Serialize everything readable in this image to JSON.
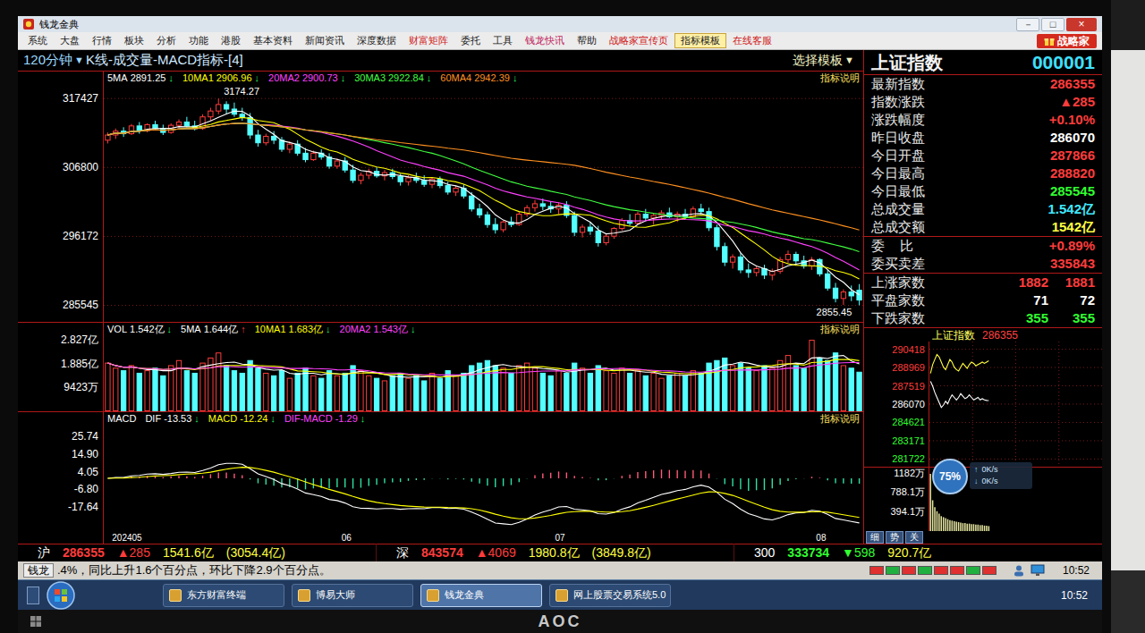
{
  "window": {
    "title": "钱龙金典",
    "controls": [
      "－",
      "□",
      "×"
    ]
  },
  "menu": {
    "items": [
      {
        "label": "系统",
        "color": "#1a1a1a",
        "highlighted": false
      },
      {
        "label": "大盘",
        "color": "#1a1a1a",
        "highlighted": false
      },
      {
        "label": "行情",
        "color": "#1a1a1a",
        "highlighted": false
      },
      {
        "label": "板块",
        "color": "#1a1a1a",
        "highlighted": false
      },
      {
        "label": "分析",
        "color": "#1a1a1a",
        "highlighted": false
      },
      {
        "label": "功能",
        "color": "#1a1a1a",
        "highlighted": false
      },
      {
        "label": "港股",
        "color": "#1a1a1a",
        "highlighted": false
      },
      {
        "label": "基本资料",
        "color": "#1a1a1a",
        "highlighted": false
      },
      {
        "label": "新闻资讯",
        "color": "#1a1a1a",
        "highlighted": false
      },
      {
        "label": "深度数据",
        "color": "#1a1a1a",
        "highlighted": false
      },
      {
        "label": "财富矩阵",
        "color": "#d01818",
        "highlighted": false
      },
      {
        "label": "委托",
        "color": "#1a1a1a",
        "highlighted": false
      },
      {
        "label": "工具",
        "color": "#1a1a1a",
        "highlighted": false
      },
      {
        "label": "钱龙快讯",
        "color": "#c0185a",
        "highlighted": false
      },
      {
        "label": "帮助",
        "color": "#1a1a1a",
        "highlighted": false
      },
      {
        "label": "战略家宣传页",
        "color": "#d01818",
        "highlighted": false
      },
      {
        "label": "指标模板",
        "color": "#1a1a1a",
        "highlighted": true
      },
      {
        "label": "在线客服",
        "color": "#d01818",
        "highlighted": false
      }
    ],
    "promo": {
      "label": "战略家"
    }
  },
  "chart_header": {
    "period": "120分钟",
    "period_arrow": "▼",
    "title": "K线-成交量-MACD指标-[4]",
    "template": "选择模板",
    "template_arrow": "▼"
  },
  "main_chart": {
    "legend": [
      {
        "label": "5MA",
        "value": "2891.25",
        "arrow": "↓",
        "rising": false,
        "color": "#ffffff",
        "period": 5
      },
      {
        "label": "10MA1",
        "value": "2906.96",
        "arrow": "↓",
        "rising": false,
        "color": "#ffff00",
        "period": 10
      },
      {
        "label": "20MA2",
        "value": "2900.73",
        "arrow": "↓",
        "rising": false,
        "color": "#ff40ff",
        "period": 20
      },
      {
        "label": "30MA3",
        "value": "2922.84",
        "arrow": "↓",
        "rising": false,
        "color": "#40ff40",
        "period": 30
      },
      {
        "label": "60MA4",
        "value": "2942.39",
        "arrow": "↓",
        "rising": false,
        "color": "#ff9020",
        "period": 60
      }
    ],
    "info": "指标说明",
    "ticks": [
      {
        "label": "317427",
        "value": 3174.27
      },
      {
        "label": "306800",
        "value": 3068.0
      },
      {
        "label": "296172",
        "value": 2961.72
      },
      {
        "label": "285545",
        "value": 2855.45
      }
    ],
    "high_label": "3174.27",
    "low_label": "2855.45",
    "candles": [
      [
        3110,
        3122,
        3105,
        3118
      ],
      [
        3118,
        3128,
        3112,
        3124
      ],
      [
        3124,
        3130,
        3115,
        3120
      ],
      [
        3120,
        3135,
        3118,
        3132
      ],
      [
        3132,
        3138,
        3120,
        3125
      ],
      [
        3125,
        3136,
        3122,
        3134
      ],
      [
        3134,
        3140,
        3126,
        3128
      ],
      [
        3128,
        3134,
        3118,
        3122
      ],
      [
        3122,
        3136,
        3120,
        3133
      ],
      [
        3133,
        3142,
        3128,
        3138
      ],
      [
        3138,
        3146,
        3130,
        3132
      ],
      [
        3132,
        3140,
        3125,
        3128
      ],
      [
        3128,
        3150,
        3126,
        3146
      ],
      [
        3146,
        3160,
        3140,
        3155
      ],
      [
        3155,
        3174.27,
        3150,
        3165
      ],
      [
        3165,
        3170,
        3150,
        3158
      ],
      [
        3158,
        3168,
        3146,
        3150
      ],
      [
        3150,
        3160,
        3140,
        3145
      ],
      [
        3145,
        3152,
        3112,
        3118
      ],
      [
        3118,
        3126,
        3100,
        3106
      ],
      [
        3106,
        3120,
        3102,
        3116
      ],
      [
        3116,
        3124,
        3104,
        3110
      ],
      [
        3110,
        3115,
        3092,
        3096
      ],
      [
        3096,
        3108,
        3090,
        3104
      ],
      [
        3104,
        3110,
        3086,
        3090
      ],
      [
        3090,
        3098,
        3076,
        3080
      ],
      [
        3080,
        3094,
        3078,
        3090
      ],
      [
        3090,
        3096,
        3080,
        3084
      ],
      [
        3084,
        3090,
        3066,
        3070
      ],
      [
        3070,
        3082,
        3066,
        3078
      ],
      [
        3078,
        3084,
        3060,
        3064
      ],
      [
        3064,
        3072,
        3044,
        3048
      ],
      [
        3048,
        3060,
        3042,
        3056
      ],
      [
        3056,
        3066,
        3050,
        3062
      ],
      [
        3062,
        3068,
        3052,
        3055
      ],
      [
        3055,
        3064,
        3048,
        3060
      ],
      [
        3060,
        3066,
        3050,
        3054
      ],
      [
        3054,
        3058,
        3040,
        3046
      ],
      [
        3046,
        3056,
        3040,
        3052
      ],
      [
        3052,
        3060,
        3044,
        3048
      ],
      [
        3048,
        3056,
        3038,
        3042
      ],
      [
        3042,
        3052,
        3036,
        3050
      ],
      [
        3050,
        3054,
        3036,
        3040
      ],
      [
        3040,
        3046,
        3026,
        3030
      ],
      [
        3030,
        3040,
        3024,
        3036
      ],
      [
        3036,
        3042,
        3020,
        3024
      ],
      [
        3024,
        3030,
        3000,
        3004
      ],
      [
        3004,
        3012,
        2990,
        2995
      ],
      [
        2995,
        3000,
        2975,
        2980
      ],
      [
        2980,
        2990,
        2966,
        2972
      ],
      [
        2972,
        2986,
        2968,
        2984
      ],
      [
        2984,
        2992,
        2976,
        2980
      ],
      [
        2980,
        3000,
        2978,
        2996
      ],
      [
        2996,
        3010,
        2992,
        3006
      ],
      [
        3006,
        3018,
        3000,
        3012
      ],
      [
        3012,
        3020,
        3002,
        3008
      ],
      [
        3008,
        3016,
        2998,
        3004
      ],
      [
        3004,
        3014,
        2996,
        3010
      ],
      [
        3010,
        3016,
        2990,
        2994
      ],
      [
        2994,
        3000,
        2962,
        2968
      ],
      [
        2968,
        2980,
        2960,
        2976
      ],
      [
        2976,
        2984,
        2964,
        2970
      ],
      [
        2970,
        2978,
        2946,
        2952
      ],
      [
        2952,
        2966,
        2948,
        2962
      ],
      [
        2962,
        2976,
        2958,
        2974
      ],
      [
        2974,
        2990,
        2970,
        2986
      ],
      [
        2986,
        2996,
        2978,
        2982
      ],
      [
        2982,
        3000,
        2980,
        2996
      ],
      [
        2996,
        3004,
        2986,
        2990
      ],
      [
        2990,
        2998,
        2980,
        2994
      ],
      [
        2994,
        3002,
        2988,
        2998
      ],
      [
        2998,
        3006,
        2990,
        2992
      ],
      [
        2992,
        3000,
        2984,
        2996
      ],
      [
        2996,
        3004,
        2988,
        2992
      ],
      [
        2992,
        3008,
        2990,
        3004
      ],
      [
        3004,
        3012,
        2996,
        3000
      ],
      [
        3000,
        3006,
        2970,
        2975
      ],
      [
        2975,
        2980,
        2940,
        2946
      ],
      [
        2946,
        2952,
        2916,
        2922
      ],
      [
        2922,
        2934,
        2912,
        2930
      ],
      [
        2930,
        2936,
        2905,
        2910
      ],
      [
        2910,
        2920,
        2898,
        2906
      ],
      [
        2906,
        2916,
        2900,
        2912
      ],
      [
        2912,
        2918,
        2896,
        2902
      ],
      [
        2902,
        2912,
        2894,
        2908
      ],
      [
        2908,
        2930,
        2904,
        2926
      ],
      [
        2926,
        2940,
        2920,
        2934
      ],
      [
        2934,
        2938,
        2918,
        2924
      ],
      [
        2924,
        2932,
        2912,
        2916
      ],
      [
        2916,
        2930,
        2910,
        2926
      ],
      [
        2926,
        2928,
        2900,
        2904
      ],
      [
        2904,
        2910,
        2878,
        2882
      ],
      [
        2882,
        2890,
        2860,
        2866
      ],
      [
        2866,
        2880,
        2856,
        2876
      ],
      [
        2876,
        2886,
        2862,
        2870
      ],
      [
        2878.66,
        2888.2,
        2855.45,
        2863.55
      ]
    ]
  },
  "volume": {
    "legend": {
      "label": "VOL",
      "value": "1.542亿",
      "arrow": "↓",
      "rising": false,
      "color": "#ffffff"
    },
    "ma": [
      {
        "label": "5MA",
        "value": "1.644亿",
        "arrow": "↑",
        "rising": true,
        "color": "#ffffff",
        "period": 5
      },
      {
        "label": "10MA1",
        "value": "1.683亿",
        "arrow": "↓",
        "rising": false,
        "color": "#ffff00",
        "period": 10
      },
      {
        "label": "20MA2",
        "value": "1.543亿",
        "arrow": "↓",
        "rising": false,
        "color": "#ff40ff",
        "period": 20
      }
    ],
    "info": "指标说明",
    "ticks": [
      {
        "label": "2.827亿",
        "value": 2.827
      },
      {
        "label": "1.885亿",
        "value": 1.885
      },
      {
        "label": "9423万",
        "value": 0.9423
      }
    ],
    "values": [
      1.9,
      1.7,
      1.6,
      1.8,
      1.5,
      1.6,
      1.7,
      1.4,
      1.8,
      2.0,
      1.6,
      1.5,
      1.9,
      2.1,
      2.3,
      1.8,
      1.6,
      1.5,
      2.0,
      1.7,
      1.5,
      1.4,
      1.6,
      1.3,
      1.5,
      1.7,
      1.4,
      1.3,
      1.6,
      1.4,
      1.5,
      1.8,
      1.6,
      1.4,
      1.3,
      1.2,
      1.4,
      1.5,
      1.3,
      1.4,
      1.2,
      1.5,
      1.3,
      1.6,
      1.4,
      1.5,
      1.8,
      1.9,
      2.0,
      1.8,
      1.7,
      1.5,
      1.8,
      1.9,
      1.7,
      1.5,
      1.4,
      1.6,
      1.5,
      1.9,
      1.7,
      1.5,
      1.8,
      1.6,
      1.5,
      1.7,
      1.5,
      1.6,
      1.4,
      1.5,
      1.3,
      1.4,
      1.5,
      1.4,
      1.6,
      1.5,
      1.9,
      2.0,
      2.1,
      1.8,
      1.9,
      1.7,
      1.6,
      1.8,
      1.7,
      2.0,
      2.2,
      1.8,
      1.7,
      2.8,
      2.1,
      2.0,
      2.3,
      1.8,
      1.7,
      1.542
    ]
  },
  "macd": {
    "title": "MACD",
    "items": [
      {
        "label": "DIF",
        "value": "-13.53",
        "arrow": "↓",
        "rising": false,
        "color": "#ffffff"
      },
      {
        "label": "MACD",
        "value": "-12.24",
        "arrow": "↓",
        "rising": false,
        "color": "#ffff00"
      },
      {
        "label": "DIF-MACD",
        "value": "-1.29",
        "arrow": "↓",
        "rising": false,
        "color": "#ff40ff"
      }
    ],
    "info": "指标说明",
    "ticks": [
      {
        "label": "25.74",
        "value": 25.74
      },
      {
        "label": "14.90",
        "value": 14.9
      },
      {
        "label": "4.05",
        "value": 4.05
      },
      {
        "label": "-6.80",
        "value": -6.8
      },
      {
        "label": "-17.64",
        "value": -17.64
      }
    ]
  },
  "x_axis": [
    {
      "label": "202405",
      "candle": 1
    },
    {
      "label": "06",
      "candle": 30
    },
    {
      "label": "07",
      "candle": 57
    },
    {
      "label": "08",
      "candle": 90
    }
  ],
  "quote": {
    "name": "上证指数",
    "code": "000001",
    "groups": [
      {
        "rows": [
          {
            "label": "最新指数",
            "values": [
              "286355"
            ],
            "color": "#ff3c3c"
          },
          {
            "label": "指数涨跌",
            "values": [
              "▲285"
            ],
            "color": "#ff3c3c"
          },
          {
            "label": "涨跌幅度",
            "values": [
              "+0.10%"
            ],
            "color": "#ff3c3c"
          },
          {
            "label": "昨日收盘",
            "values": [
              "286070"
            ],
            "color": "#ffffff"
          },
          {
            "label": "今日开盘",
            "values": [
              "287866"
            ],
            "color": "#ff3c3c"
          },
          {
            "label": "今日最高",
            "values": [
              "288820"
            ],
            "color": "#ff3c3c"
          },
          {
            "label": "今日最低",
            "values": [
              "285545"
            ],
            "color": "#30ff30"
          },
          {
            "label": "总成交量",
            "values": [
              "1.542亿"
            ],
            "color": "#40e8ff"
          },
          {
            "label": "总成交额",
            "values": [
              "1542亿"
            ],
            "color": "#ffff40"
          }
        ]
      },
      {
        "rows": [
          {
            "label": "委    比",
            "values": [
              "+0.89%"
            ],
            "color": "#ff3c3c"
          },
          {
            "label": "委买卖差",
            "values": [
              "335843"
            ],
            "color": "#ff3c3c"
          }
        ]
      },
      {
        "rows": [
          {
            "label": "上涨家数",
            "values": [
              "1882",
              "1881"
            ],
            "color": "#ff3c3c"
          },
          {
            "label": "平盘家数",
            "values": [
              "71",
              "72"
            ],
            "color": "#ffffff"
          },
          {
            "label": "下跌家数",
            "values": [
              "355",
              "355"
            ],
            "color": "#30ff30"
          }
        ]
      }
    ]
  },
  "intraday": {
    "name": "上证指数",
    "value": "286355",
    "price_ticks": [
      {
        "label": "290418",
        "value": 2904.18,
        "color": "#ff3c3c"
      },
      {
        "label": "288969",
        "value": 2889.69,
        "color": "#ff3c3c"
      },
      {
        "label": "287519",
        "value": 2875.19,
        "color": "#ff3c3c"
      },
      {
        "label": "286070",
        "value": 2860.7,
        "color": "#ffffff"
      },
      {
        "label": "284621",
        "value": 2846.21,
        "color": "#30ff30"
      },
      {
        "label": "283171",
        "value": 2831.71,
        "color": "#30ff30"
      },
      {
        "label": "281722",
        "value": 2817.22,
        "color": "#30ff30"
      }
    ],
    "volume_ticks": [
      {
        "label": "1182万",
        "value": 1182
      },
      {
        "label": "788.1万",
        "value": 788.1
      },
      {
        "label": "394.1万",
        "value": 394.1
      }
    ],
    "slots": 80,
    "index": [
      2878.7,
      2875,
      2870,
      2866,
      2862,
      2858,
      2860,
      2863,
      2861,
      2865,
      2868,
      2866,
      2864,
      2866,
      2869,
      2867,
      2865,
      2866,
      2868,
      2866,
      2864,
      2865,
      2866,
      2864,
      2865,
      2864,
      2863.6,
      2863.55
    ],
    "lead": [
      2885,
      2892,
      2896,
      2900,
      2898,
      2894,
      2890,
      2888,
      2892,
      2896,
      2894,
      2890,
      2888,
      2887,
      2890,
      2893,
      2891,
      2889,
      2892,
      2894,
      2893,
      2891,
      2892,
      2893,
      2894,
      2893,
      2894,
      2895
    ],
    "volume": [
      1150,
      620,
      480,
      400,
      350,
      300,
      280,
      260,
      240,
      220,
      210,
      200,
      190,
      180,
      170,
      160,
      160,
      150,
      150,
      140,
      140,
      130,
      130,
      120,
      120,
      110,
      110,
      100
    ],
    "tabs": [
      {
        "label": "细",
        "selected": false
      },
      {
        "label": "势",
        "selected": false
      },
      {
        "label": "关",
        "selected": false
      }
    ]
  },
  "net_widget": {
    "percent": "75%",
    "up_icon": "↑",
    "up": "0K/s",
    "down_icon": "↓",
    "down": "0K/s"
  },
  "ticker": [
    {
      "label": "沪",
      "value": "286355",
      "change": "▲285",
      "amount": "1541.6亿",
      "amount2": "(3054.4亿)",
      "color": "#ff3c3c"
    },
    {
      "label": "深",
      "value": "843574",
      "change": "▲4069",
      "amount": "1980.8亿",
      "amount2": "(3849.8亿)",
      "color": "#ff3c3c"
    },
    {
      "label": "300",
      "value": "333734",
      "change": "▼598",
      "amount": "920.7亿",
      "color": "#30ff30"
    }
  ],
  "news": {
    "source": "钱龙",
    "text": ".4%，同比上升1.6个百分点，环比下降2.9个百分点。",
    "clock": "10:52"
  },
  "status_blocks": [
    {
      "color": "#e03030"
    },
    {
      "color": "#20b040"
    },
    {
      "color": "#e03030"
    },
    {
      "color": "#20b040"
    },
    {
      "color": "#e03030"
    },
    {
      "color": "#e03030"
    },
    {
      "color": "#20b040"
    },
    {
      "color": "#e03030"
    }
  ],
  "taskbar": {
    "items": [
      {
        "label": "东方财富终端",
        "selected": false
      },
      {
        "label": "博易大师",
        "selected": false
      },
      {
        "label": "钱龙金典",
        "selected": true
      },
      {
        "label": "网上股票交易系统5.0",
        "selected": false
      }
    ],
    "clock": "10:52"
  },
  "monitor": {
    "brand": "AOC"
  }
}
